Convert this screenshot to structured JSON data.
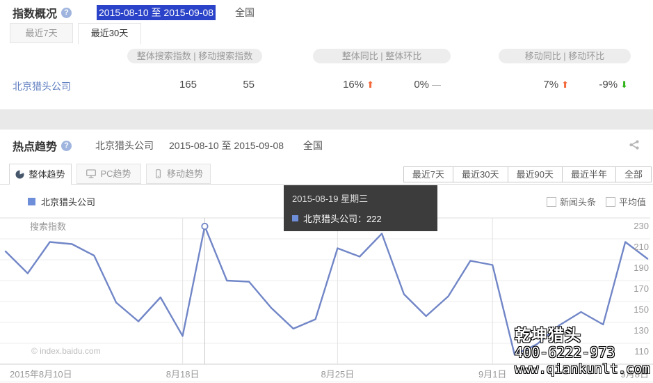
{
  "colors": {
    "line": "#7186c7",
    "up": "#f26a3c",
    "down": "#2fb318",
    "flat": "#999999",
    "selection_bg": "#2b43c8",
    "tooltip_bg": "#343434"
  },
  "overview": {
    "title": "指数概况",
    "help": "?",
    "date_range": "2015-08-10 至 2015-09-08",
    "region": "全国",
    "tabs": [
      {
        "label": "最近7天",
        "active": false
      },
      {
        "label": "最近30天",
        "active": true
      }
    ],
    "col_groups": [
      "整体搜索指数  |  移动搜索指数",
      "整体同比  |  整体环比",
      "移动同比  |  移动环比"
    ],
    "row": {
      "keyword": "北京猎头公司",
      "overall_index": "165",
      "mobile_index": "55",
      "overall_yoy": {
        "value": "16%",
        "dir": "up"
      },
      "overall_mom": {
        "value": "0%",
        "dir": "flat"
      },
      "mobile_yoy": {
        "value": "7%",
        "dir": "up"
      },
      "mobile_mom": {
        "value": "-9%",
        "dir": "down"
      }
    }
  },
  "trend": {
    "title": "热点趋势",
    "help": "?",
    "keyword": "北京猎头公司",
    "date_range": "2015-08-10 至 2015-09-08",
    "region": "全国",
    "tabs": [
      {
        "label": "整体趋势",
        "icon": "pie-chart-icon",
        "active": true
      },
      {
        "label": "PC趋势",
        "icon": "desktop-icon",
        "active": false
      },
      {
        "label": "移动趋势",
        "icon": "mobile-icon",
        "active": false
      }
    ],
    "ranges": [
      "最近7天",
      "最近30天",
      "最近90天",
      "最近半年",
      "全部"
    ],
    "legend": "北京猎头公司",
    "checkboxes": [
      {
        "label": "新闻头条",
        "checked": false
      },
      {
        "label": "平均值",
        "checked": false
      }
    ],
    "tooltip": {
      "date": "2015-08-19 星期三",
      "line": "北京猎头公司：222"
    },
    "axis_label": "搜索指数",
    "copyright": "© index.baidu.com",
    "watermark": {
      "line1": "乾坤猎头",
      "line2": "400-6222-973",
      "line3": "www.qiankunlt.com"
    }
  },
  "chart_data": {
    "type": "line",
    "title": "热点趋势 - 整体趋势",
    "ylabel": "搜索指数",
    "ylim": [
      90,
      230
    ],
    "yticks": [
      230,
      210,
      190,
      170,
      150,
      130,
      110
    ],
    "grid": true,
    "legend_position": "top-left",
    "x_tick_labels": [
      "2015年8月10日",
      "8月18日",
      "8月25日",
      "9月1日",
      "9月8日"
    ],
    "x_tick_indices": [
      0,
      8,
      15,
      22,
      29
    ],
    "dates": [
      "2015-08-10",
      "2015-08-11",
      "2015-08-12",
      "2015-08-13",
      "2015-08-14",
      "2015-08-15",
      "2015-08-16",
      "2015-08-17",
      "2015-08-18",
      "2015-08-19",
      "2015-08-20",
      "2015-08-21",
      "2015-08-22",
      "2015-08-23",
      "2015-08-24",
      "2015-08-25",
      "2015-08-26",
      "2015-08-27",
      "2015-08-28",
      "2015-08-29",
      "2015-08-30",
      "2015-08-31",
      "2015-09-01",
      "2015-09-02",
      "2015-09-03",
      "2015-09-04",
      "2015-09-05",
      "2015-09-06",
      "2015-09-07",
      "2015-09-08"
    ],
    "series": [
      {
        "name": "北京猎头公司",
        "values": [
          198,
          177,
          207,
          205,
          194,
          149,
          131,
          154,
          117,
          222,
          170,
          169,
          144,
          124,
          133,
          201,
          193,
          215,
          157,
          136,
          155,
          189,
          185,
          99,
          109,
          127,
          140,
          128,
          207,
          191
        ]
      }
    ],
    "highlight": {
      "index": 9,
      "date": "2015-08-19",
      "weekday": "星期三",
      "value": 222
    }
  }
}
